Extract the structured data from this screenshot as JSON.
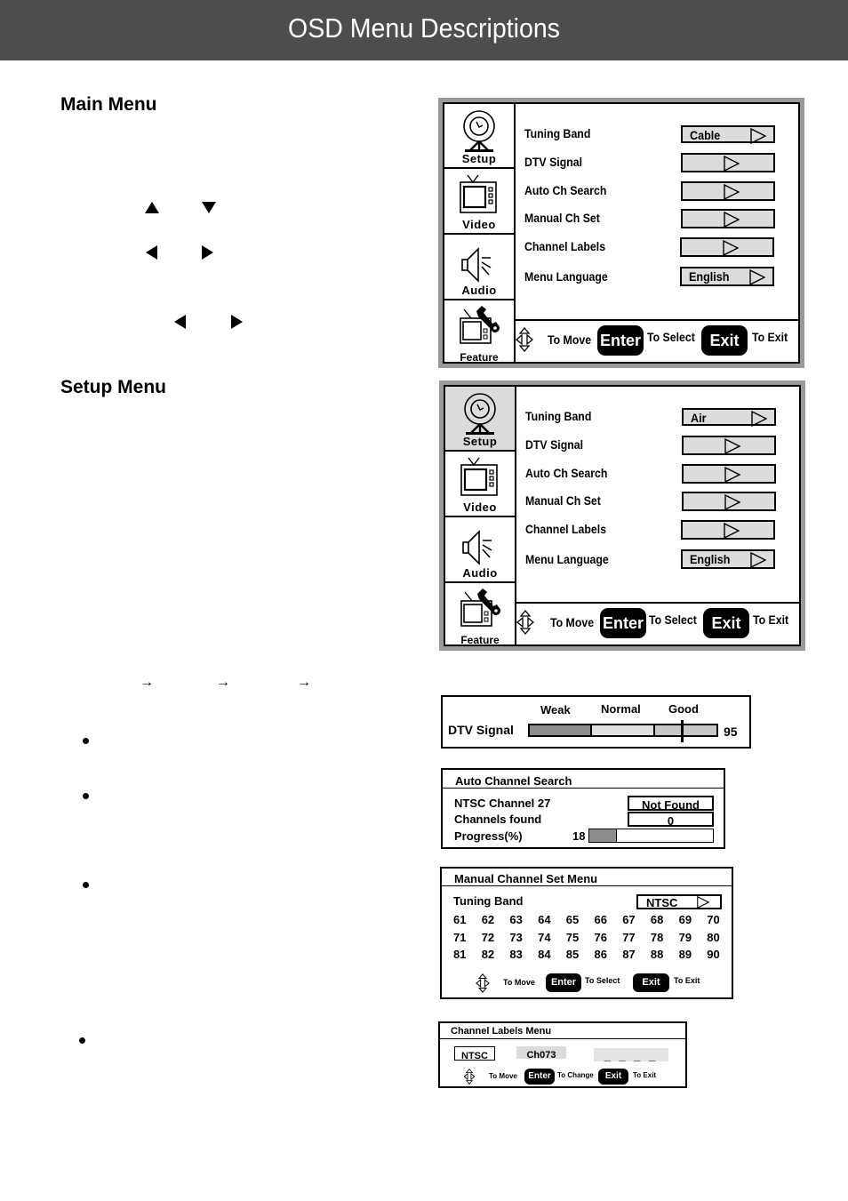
{
  "header": {
    "title": "OSD Menu Descriptions",
    "bg_color": "#4d4d4d"
  },
  "main_menu": {
    "title": "Main Menu",
    "nav_glyphs": [
      "up-arrow",
      "down-arrow",
      "left-arrow",
      "right-arrow",
      "left-arrow",
      "right-arrow"
    ]
  },
  "setup_menu": {
    "title": "Setup Menu",
    "flow_arrow": "→"
  },
  "osd_main": {
    "tabs": [
      {
        "label": "Setup",
        "icon": "satellite-dish-icon",
        "active": false
      },
      {
        "label": "Video",
        "icon": "tv-icon",
        "active": false
      },
      {
        "label": "Audio",
        "icon": "speaker-icon",
        "active": false
      },
      {
        "label": "Feature",
        "icon": "tv-wrench-icon",
        "active": false
      }
    ],
    "rows": [
      {
        "label": "Tuning Band",
        "value": "Cable"
      },
      {
        "label": "DTV Signal",
        "value": ""
      },
      {
        "label": "Auto Ch Search",
        "value": ""
      },
      {
        "label": "Manual Ch Set",
        "value": ""
      },
      {
        "label": "Channel Labels",
        "value": ""
      },
      {
        "label": "Menu Language",
        "value": "English"
      }
    ],
    "footer": {
      "move": "To Move",
      "enter": "Enter",
      "select": "To Select",
      "exit": "Exit",
      "to_exit": "To Exit"
    }
  },
  "osd_setup": {
    "tabs": [
      {
        "label": "Setup",
        "icon": "satellite-dish-icon",
        "active": true
      },
      {
        "label": "Video",
        "icon": "tv-icon",
        "active": false
      },
      {
        "label": "Audio",
        "icon": "speaker-icon",
        "active": false
      },
      {
        "label": "Feature",
        "icon": "tv-wrench-icon",
        "active": false
      }
    ],
    "rows": [
      {
        "label": "Tuning Band",
        "value": "Air"
      },
      {
        "label": "DTV Signal",
        "value": ""
      },
      {
        "label": "Auto Ch Search",
        "value": ""
      },
      {
        "label": "Manual Ch Set",
        "value": ""
      },
      {
        "label": "Channel Labels",
        "value": ""
      },
      {
        "label": "Menu Language",
        "value": "English"
      }
    ],
    "footer": {
      "move": "To Move",
      "enter": "Enter",
      "select": "To Select",
      "exit": "Exit",
      "to_exit": "To Exit"
    }
  },
  "dtv_signal": {
    "label": "DTV Signal",
    "levels": [
      "Weak",
      "Normal",
      "Good"
    ],
    "value": "95",
    "value_fraction": 0.81
  },
  "auto_search": {
    "title": "Auto Channel Search",
    "channel_label": "NTSC Channel 27",
    "channel_status": "Not Found",
    "found_label": "Channels found",
    "found_value": "0",
    "progress_label": "Progress(%)",
    "progress_value": "18",
    "progress_percent": 18
  },
  "manual_set": {
    "title": "Manual Channel Set Menu",
    "band_label": "Tuning Band",
    "band_value": "NTSC",
    "channels": [
      [
        "61",
        "62",
        "63",
        "64",
        "65",
        "66",
        "67",
        "68",
        "69",
        "70"
      ],
      [
        "71",
        "72",
        "73",
        "74",
        "75",
        "76",
        "77",
        "78",
        "79",
        "80"
      ],
      [
        "81",
        "82",
        "83",
        "84",
        "85",
        "86",
        "87",
        "88",
        "89",
        "90"
      ]
    ],
    "footer": {
      "move": "To Move",
      "enter": "Enter",
      "select": "To Select",
      "exit": "Exit",
      "to_exit": "To Exit"
    }
  },
  "channel_labels": {
    "title": "Channel Labels Menu",
    "band": "NTSC",
    "channel": "Ch073",
    "label_slots": "_ _ _ _",
    "footer": {
      "move": "To Move",
      "enter": "Enter",
      "change": "To Change",
      "exit": "Exit",
      "to_exit": "To Exit"
    }
  }
}
